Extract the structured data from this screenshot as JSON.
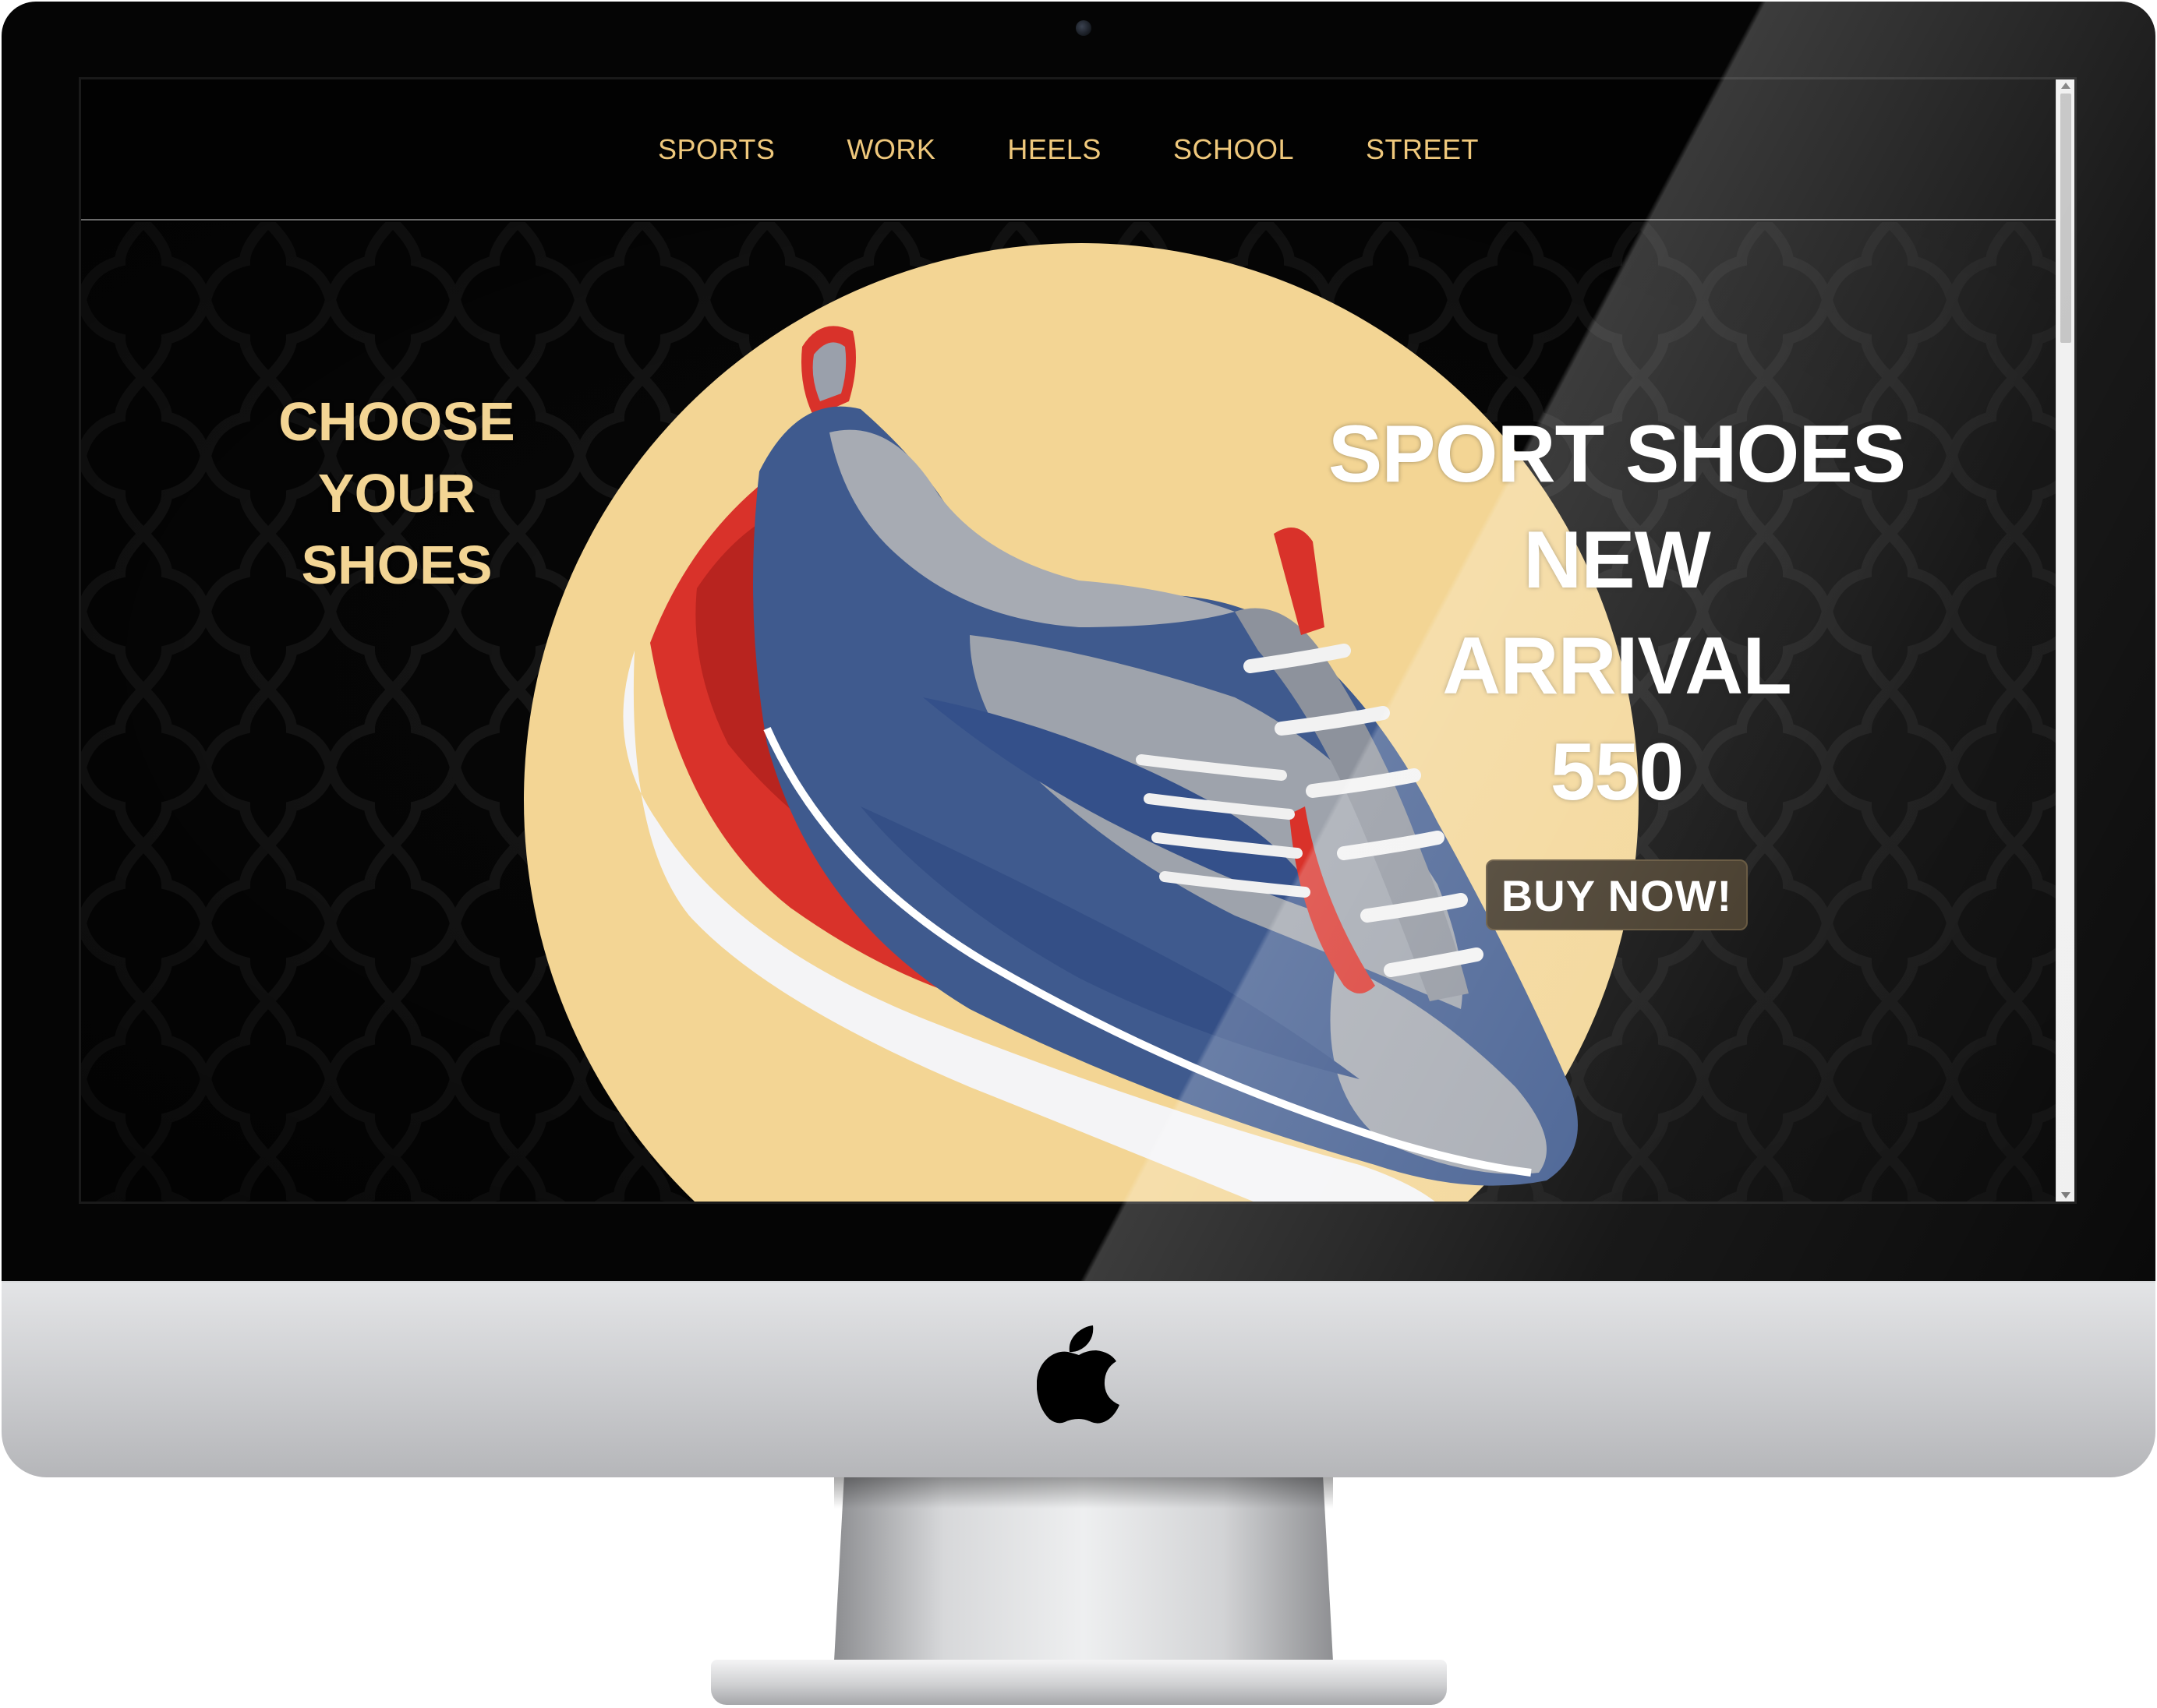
{
  "nav": {
    "items": [
      {
        "label": "SPORTS"
      },
      {
        "label": "WORK"
      },
      {
        "label": "HEELS"
      },
      {
        "label": "SCHOOL"
      },
      {
        "label": "STREET"
      }
    ]
  },
  "hero": {
    "choose_title": [
      "CHOOSE",
      "YOUR",
      "SHOES"
    ],
    "promo_lines": [
      "SPORT SHOES",
      "NEW",
      "ARRIVAL",
      "550"
    ],
    "buy_button_label": "BUY NOW!",
    "product_image": "sport-shoe-image"
  },
  "colors": {
    "accent_gold": "#efc87c",
    "circle_cream": "#f3d594",
    "background": "#000000",
    "button_brown": "#3a2f1e"
  },
  "icons": {
    "device_logo": "apple-logo-icon",
    "camera": "camera-icon"
  }
}
